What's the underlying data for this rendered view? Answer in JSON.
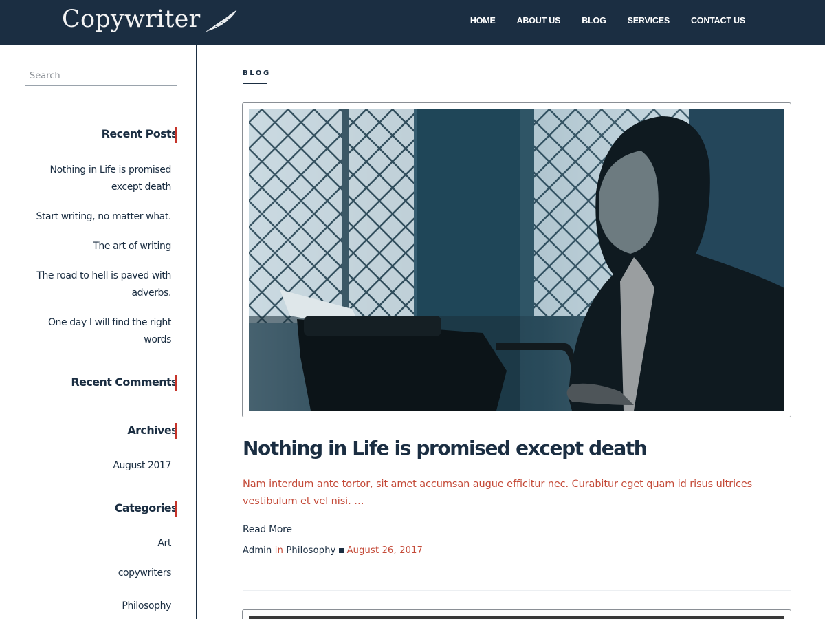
{
  "header": {
    "logo": "Copywriter",
    "nav": [
      "HOME",
      "ABOUT US",
      "BLOG",
      "SERVICES",
      "CONTACT US"
    ]
  },
  "sidebar": {
    "search_placeholder": "Search",
    "recent_posts_title": "Recent Posts",
    "recent_posts": [
      "Nothing in Life is promised except death",
      "Start writing, no matter what.",
      "The art of writing",
      "The road to hell is paved with adverbs.",
      "One day I will find the right words"
    ],
    "recent_comments_title": "Recent Comments",
    "archives_title": "Archives",
    "archives": [
      "August 2017"
    ],
    "categories_title": "Categories",
    "categories": [
      "Art",
      "copywriters",
      "Philosophy"
    ]
  },
  "main": {
    "breadcrumb": "BLOG",
    "post": {
      "title": "Nothing in Life is promised except death",
      "excerpt": "Nam interdum ante tortor, sit amet accumsan augue efficitur nec. Curabitur eget quam id risus ultrices vestibulum et vel nisi. …",
      "read_more": "Read More",
      "author": "Admin",
      "in_word": "in",
      "category": "Philosophy",
      "date": "August 26, 2017"
    }
  },
  "colors": {
    "header_bg": "#1b2e42",
    "accent": "#c6342a",
    "excerpt": "#c44a38"
  }
}
